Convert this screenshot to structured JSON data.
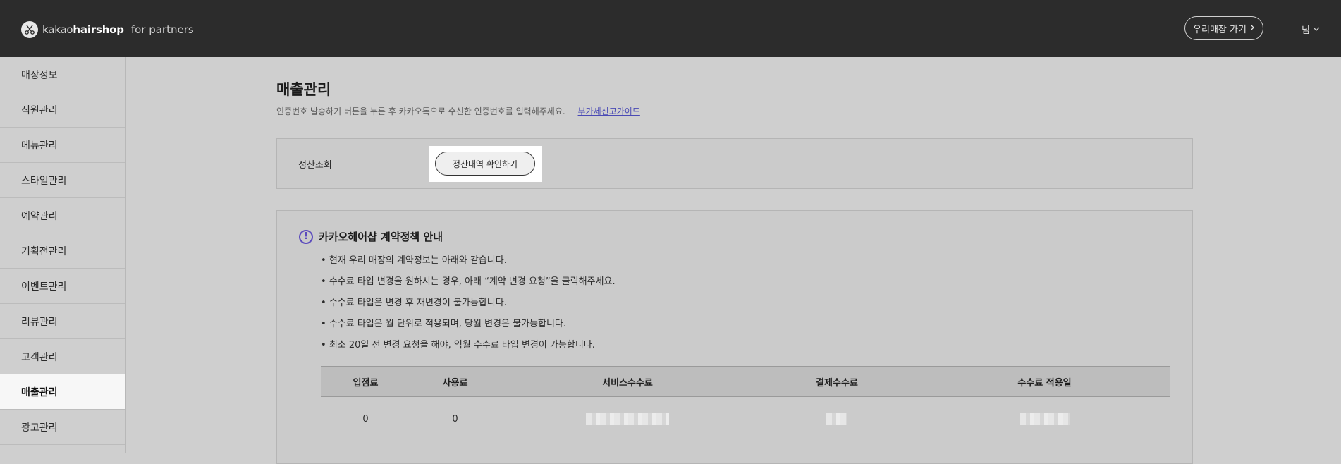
{
  "header": {
    "logo_brand_light": "kakao",
    "logo_brand_bold": "hairshop",
    "logo_suffix": "for partners",
    "store_button_label": "우리매장 가기",
    "user_label": "님"
  },
  "sidebar": {
    "items": [
      {
        "label": "매장정보"
      },
      {
        "label": "직원관리"
      },
      {
        "label": "메뉴관리"
      },
      {
        "label": "스타일관리"
      },
      {
        "label": "예약관리"
      },
      {
        "label": "기획전관리"
      },
      {
        "label": "이벤트관리"
      },
      {
        "label": "리뷰관리"
      },
      {
        "label": "고객관리"
      },
      {
        "label": "매출관리",
        "active": true
      },
      {
        "label": "광고관리"
      }
    ]
  },
  "main": {
    "title": "매출관리",
    "description": "인증번호 발송하기 버튼을 누른 후 카카오톡으로 수신한 인증번호를 입력해주세요.",
    "guide_link": "부가세신고가이드",
    "settlement": {
      "label": "정산조회",
      "button_label": "정산내역 확인하기"
    },
    "policy": {
      "title": "카카오헤어샵 계약정책 안내",
      "items": [
        "현재 우리 매장의 계약정보는 아래와 같습니다.",
        "수수료 타입 변경을 원하시는 경우, 아래 “계약 변경 요청”을 클릭해주세요.",
        "수수료 타입은 변경 후 재변경이 불가능합니다.",
        "수수료 타입은 월 단위로 적용되며, 당월 변경은 불가능합니다.",
        "최소 20일 전 변경 요청을 해야, 익월 수수료 타입 변경이 가능합니다."
      ],
      "table": {
        "headers": [
          "입점료",
          "사용료",
          "서비스수수료",
          "결제수수료",
          "수수료 적용일"
        ],
        "row": [
          "0",
          "0"
        ]
      }
    }
  },
  "colors": {
    "header_bg": "#2c2c2c",
    "accent": "#5b4bbd",
    "link": "#4a4ab5"
  }
}
